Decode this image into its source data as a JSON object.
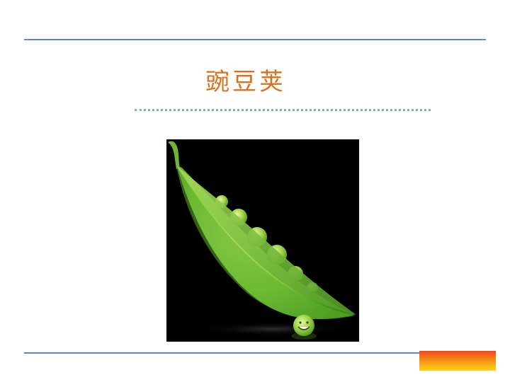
{
  "slide": {
    "title": "豌豆荚"
  },
  "image": {
    "subject": "pea-pod-icon"
  },
  "colors": {
    "rule": "#5b86b5",
    "title": "#d9711e",
    "dotted_rule": "#8fa8c4",
    "photo_background": "#000000",
    "pod_green": "#7cc63a",
    "accent_bar_top": "#f0461c",
    "accent_bar_bottom": "#fbd316"
  }
}
